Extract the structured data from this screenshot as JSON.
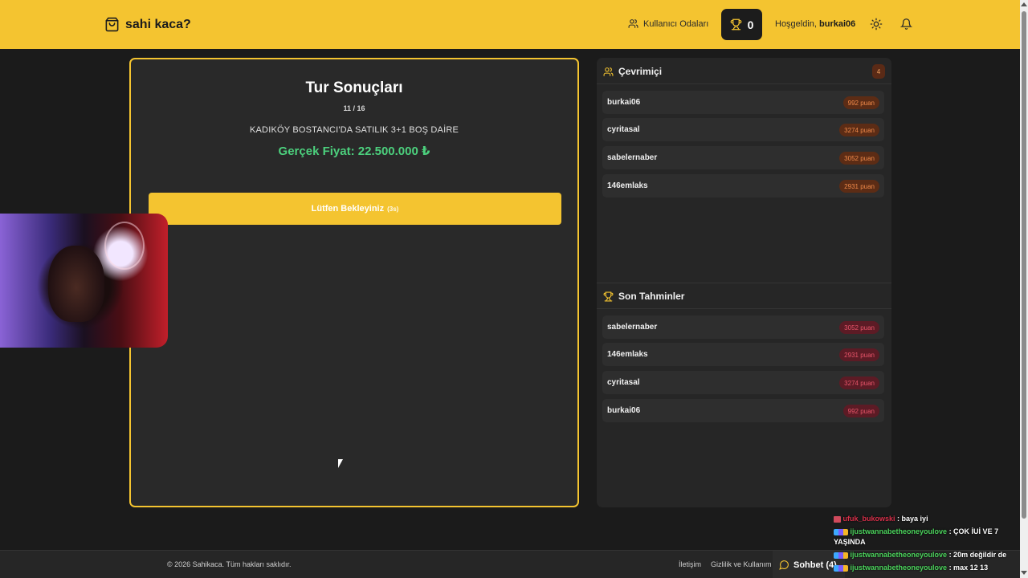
{
  "header": {
    "logo_text": "sahi kaca?",
    "rooms_label": "Kullanıcı Odaları",
    "trophy_count": "0",
    "welcome_prefix": "Hoşgeldin,",
    "username": "burkai06",
    "accent_color": "#f4c430"
  },
  "results": {
    "title": "Tur Sonuçları",
    "round": "11 / 16",
    "property": "KADIKÖY BOSTANCI'DA SATILIK 3+1 BOŞ DAİRE",
    "real_price": "Gerçek Fiyat: 22.500.000 ₺",
    "wait_label": "Lütfen Bekleyiniz",
    "wait_seconds": "(3s)"
  },
  "online": {
    "title": "Çevrimiçi",
    "count": "4",
    "users": [
      {
        "name": "burkai06",
        "points": "992 puan"
      },
      {
        "name": "cyritasal",
        "points": "3274 puan"
      },
      {
        "name": "sabelernaber",
        "points": "3052 puan"
      },
      {
        "name": "146emlaks",
        "points": "2931 puan"
      }
    ]
  },
  "guesses": {
    "title": "Son Tahminler",
    "users": [
      {
        "name": "sabelernaber",
        "points": "3052 puan"
      },
      {
        "name": "146emlaks",
        "points": "2931 puan"
      },
      {
        "name": "cyritasal",
        "points": "3274 puan"
      },
      {
        "name": "burkai06",
        "points": "992 puan"
      }
    ]
  },
  "footer": {
    "copyright": "© 2026 Sahikaca. Tüm hakları saklıdır.",
    "contact": "İletişim",
    "privacy": "Gizlilik ve Kullanım",
    "chat_label": "Sohbet (4)"
  },
  "stream_chat": [
    {
      "user": "ufuk_bukowski",
      "message": ": baya iyi"
    },
    {
      "user": "ijustwannabetheoneyoulove",
      "message": ": ÇOK İUİ VE 7 YAŞINDA"
    },
    {
      "user": "ijustwannabetheoneyoulove",
      "message": ": 20m değildir de"
    },
    {
      "user": "ijustwannabetheoneyoulove",
      "message": ": max 12 13"
    }
  ]
}
